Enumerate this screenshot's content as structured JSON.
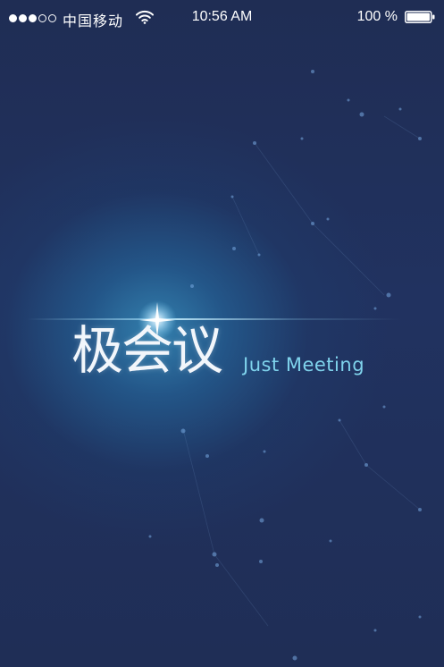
{
  "status_bar": {
    "signal_dots_filled": 3,
    "signal_dots_total": 5,
    "carrier": "中国移动",
    "time": "10:56 AM",
    "battery_percent": "100 %",
    "battery_level": 1.0,
    "wifi_icon": "wifi-icon",
    "battery_icon": "battery-icon"
  },
  "splash": {
    "logo_cn": "极会议",
    "logo_en": "Just Meeting"
  },
  "colors": {
    "background": "#1f2d54",
    "glow": "#3484b2",
    "logo_en": "#7fd3ec",
    "text": "#ffffff"
  }
}
